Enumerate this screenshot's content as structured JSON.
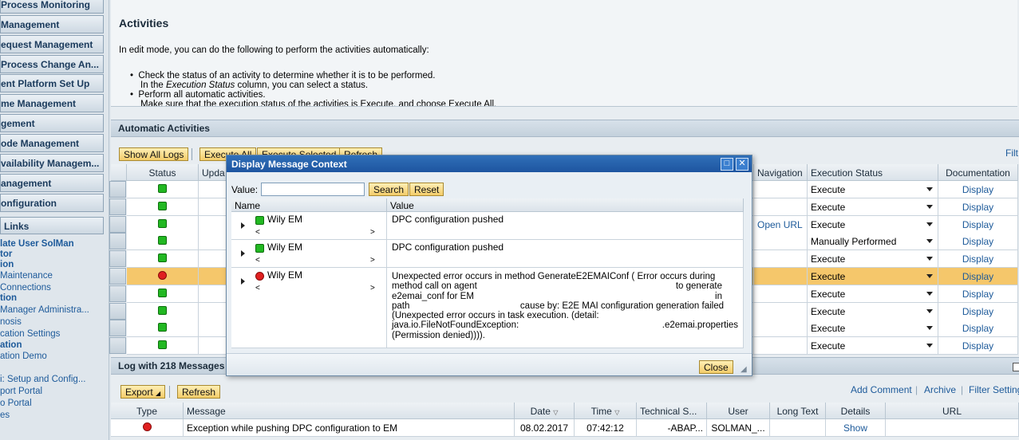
{
  "sidebar": {
    "nav": [
      "Process Monitoring",
      "Management",
      "equest Management",
      "Process Change An...",
      "ent Platform Set Up",
      "me Management",
      "gement",
      "ode Management",
      "vailability Managem...",
      "anagement",
      "onfiguration"
    ],
    "links_title": "Links",
    "links": [
      "late User SolMan",
      "tor",
      "ion",
      "Maintenance",
      "Connections",
      "tion",
      "Manager Administra...",
      "nosis",
      "cation Settings",
      "ation",
      "ation Demo",
      "i: Setup and Config...",
      "port Portal",
      "o Portal",
      "es"
    ]
  },
  "activities": {
    "title": "Activities",
    "intro": "In edit mode, you can do the following to perform the activities automatically:",
    "bullet1_a": "Check the status of an activity to determine whether it is to be performed.",
    "bullet1_b_pre": "In the ",
    "bullet1_b_em": "Execution Status",
    "bullet1_b_post": " column, you can select a status.",
    "bullet2": "Perform all automatic activities.",
    "bullet3_partial": "Make sure that the execution status of the activities is Execute, and choose Execute All."
  },
  "auto": {
    "title": "Automatic Activities",
    "buttons": {
      "show_logs": "Show All Logs",
      "execute_all": "Execute All",
      "execute_selected": "Execute Selected",
      "refresh": "Refresh"
    },
    "filter": "Filt",
    "columns": {
      "status": "Status",
      "update": "Upda",
      "navigation": "Navigation",
      "exec_status": "Execution Status",
      "documentation": "Documentation"
    },
    "rows": [
      {
        "status": "green",
        "nav": "",
        "exec": "Execute",
        "doc": "Display",
        "highlight": false
      },
      {
        "status": "green",
        "nav": "",
        "exec": "Execute",
        "doc": "Display",
        "highlight": false
      },
      {
        "status": "green",
        "nav": "Open URL",
        "exec": "Execute",
        "doc": "Display",
        "highlight": false
      },
      {
        "status": "green",
        "nav": "",
        "exec": "Manually Performed",
        "doc": "Display",
        "highlight": false
      },
      {
        "status": "green",
        "nav": "",
        "exec": "Execute",
        "doc": "Display",
        "highlight": false
      },
      {
        "status": "red",
        "nav": "",
        "exec": "Execute",
        "doc": "Display",
        "highlight": true
      },
      {
        "status": "green",
        "nav": "",
        "exec": "Execute",
        "doc": "Display",
        "highlight": false
      },
      {
        "status": "green",
        "nav": "",
        "exec": "Execute",
        "doc": "Display",
        "highlight": false
      },
      {
        "status": "green",
        "nav": "",
        "exec": "Execute",
        "doc": "Display",
        "highlight": false
      },
      {
        "status": "green",
        "nav": "",
        "exec": "Execute",
        "doc": "Display",
        "highlight": false
      }
    ]
  },
  "log": {
    "title": "Log with 218 Messages f",
    "export": "Export",
    "refresh": "Refresh",
    "add_comment": "Add Comment",
    "archive": "Archive",
    "filter_settings": "Filter Setting",
    "columns": {
      "type": "Type",
      "message": "Message",
      "date": "Date",
      "time": "Time",
      "tech": "Technical S...",
      "user": "User",
      "long_text": "Long Text",
      "details": "Details",
      "url": "URL"
    },
    "row": {
      "message": "Exception while pushing DPC configuration to EM",
      "date": "08.02.2017",
      "time": "07:42:12",
      "tech": "-ABAP...",
      "user": "SOLMAN_...",
      "details": "Show"
    }
  },
  "modal": {
    "title": "Display Message Context",
    "value_label": "Value:",
    "search": "Search",
    "reset": "Reset",
    "col_name": "Name",
    "col_value": "Value",
    "rows": [
      {
        "status": "green",
        "name": "Wily EM",
        "lt": "<",
        "gt": ">",
        "value": "DPC configuration pushed"
      },
      {
        "status": "green",
        "name": "Wily EM",
        "lt": "<",
        "gt": ">",
        "value": "DPC configuration pushed"
      },
      {
        "status": "red",
        "name": "Wily EM",
        "lt": "<",
        "gt": ">"
      }
    ],
    "err": {
      "l1": "Unexpected error occurs in method GenerateE2EMAIConf ( Error occurs during",
      "l2a": "method call on agent",
      "l2b": "to generate",
      "l3a": "e2emai_conf for EM",
      "l3b": "in",
      "l4a": "path",
      "l4b": "cause by: E2E MAI configuration generation failed",
      "l5": "(Unexpected error occurs in task execution. (detail:",
      "l6a": "java.io.FileNotFoundException:",
      "l6b": ".e2emai.properties",
      "l7": "(Permission denied))))."
    },
    "close": "Close"
  }
}
